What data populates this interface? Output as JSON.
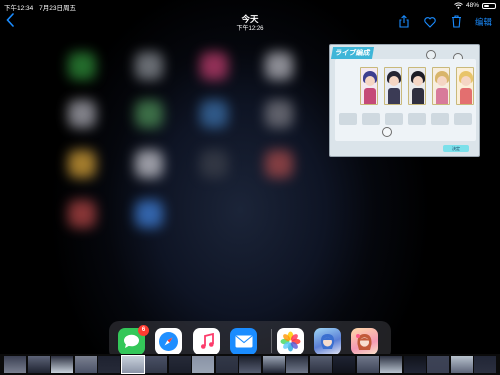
{
  "status_bar": {
    "time": "下午12:34",
    "date": "7月23日周五",
    "battery_percent": "48%",
    "battery_level": 0.48,
    "wifi_icon": "wifi-icon",
    "battery_icon": "battery-icon"
  },
  "nav": {
    "title": "今天",
    "subtitle": "下午12:26",
    "edit_label": "编辑",
    "icons": [
      "back-chevron-icon",
      "share-icon",
      "heart-icon",
      "trash-icon"
    ]
  },
  "colors": {
    "accent": "#1a8cff",
    "badge": "#ff3b30",
    "background": "#000000"
  },
  "preview": {
    "title": "ライブ編成",
    "button_label": "決定"
  },
  "dock": {
    "apps": [
      {
        "name": "messages",
        "icon": "message-bubble-icon",
        "badge": "6"
      },
      {
        "name": "safari",
        "icon": "compass-icon"
      },
      {
        "name": "music",
        "icon": "music-note-icon"
      },
      {
        "name": "mail",
        "icon": "envelope-icon"
      },
      {
        "name": "photos",
        "icon": "photos-flower-icon"
      },
      {
        "name": "recent-app-1",
        "icon": "anime-character-icon"
      },
      {
        "name": "recent-app-2",
        "icon": "anime-character-icon"
      }
    ]
  },
  "filmstrip": {
    "frame_count": 21,
    "selected_index": 5
  }
}
